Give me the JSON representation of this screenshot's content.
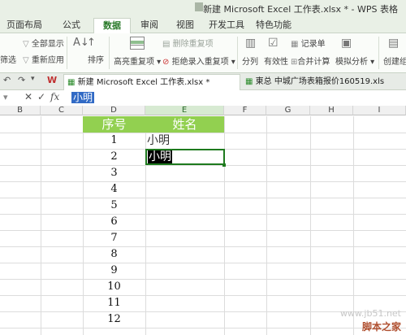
{
  "window": {
    "title": "新建 Microsoft Excel 工作表.xlsx * - WPS 表格"
  },
  "tabs": [
    "页面布局",
    "公式",
    "数据",
    "审阅",
    "视图",
    "开发工具",
    "特色功能"
  ],
  "active_tab": "数据",
  "ribbon": {
    "show_all": "全部显示",
    "reapply": "重新应用",
    "filter_partial": "筛选",
    "sort": "排序",
    "highlight_dup": "高亮重复项",
    "delete_dup": "删除重复项",
    "reject_dup": "拒绝录入重复项",
    "split": "分列",
    "validity": "有效性",
    "record": "记录单",
    "merge_calc": "合并计算",
    "simulate": "模拟分析",
    "create_group": "创建组"
  },
  "doc_tabs": [
    {
      "label": "新建 Microsoft Excel 工作表.xlsx *",
      "active": true
    },
    {
      "label": "東总 中城广场表箱报价160519.xls",
      "active": false
    }
  ],
  "formula_bar": {
    "fx": "fx",
    "value": "小明"
  },
  "columns": [
    "B",
    "C",
    "D",
    "E",
    "F",
    "G",
    "H",
    "I"
  ],
  "table": {
    "header": [
      "序号",
      "姓名"
    ],
    "numbers": [
      "1",
      "2",
      "3",
      "4",
      "5",
      "6",
      "7",
      "8",
      "9",
      "10",
      "11",
      "12"
    ],
    "names": [
      "小明",
      "小明"
    ]
  },
  "watermark": {
    "site": "脚本之家",
    "url": "www.jb51.net"
  },
  "colors": {
    "header_fill": "#92d050",
    "active_border": "#1e7a1e",
    "accent_tab": "#2a7a2a"
  }
}
